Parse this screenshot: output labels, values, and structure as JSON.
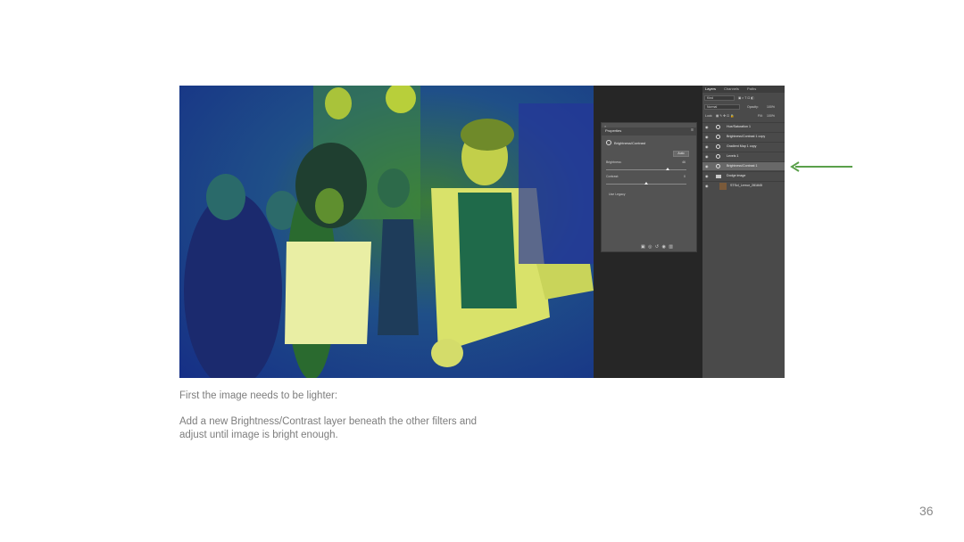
{
  "photoshop": {
    "properties_panel": {
      "tab_label": "Properties",
      "adjustment_title": "Brightness/Contrast",
      "auto_button": "Auto",
      "brightness": {
        "label": "Brightness:",
        "value": "46"
      },
      "contrast": {
        "label": "Contrast:",
        "value": "0"
      },
      "use_legacy_label": "Use Legacy"
    },
    "layers_panel": {
      "tabs": [
        "Layers",
        "Channels",
        "Paths"
      ],
      "filter_kind": "Kind",
      "blend_mode": "Normal",
      "opacity_label": "Opacity:",
      "opacity_value": "100%",
      "lock_label": "Lock:",
      "fill_label": "Fill:",
      "fill_value": "100%",
      "layers": [
        {
          "name": "Hue/Saturation 1",
          "type": "adjustment",
          "selected": false
        },
        {
          "name": "Brightness/Contrast 1 copy",
          "type": "adjustment",
          "selected": false
        },
        {
          "name": "Gradient Map 1 copy",
          "type": "adjustment",
          "selected": false
        },
        {
          "name": "Levels 1",
          "type": "adjustment",
          "selected": false
        },
        {
          "name": "Brightness/Contrast 1",
          "type": "adjustment",
          "selected": true
        },
        {
          "name": "Dodge image",
          "type": "group",
          "selected": false
        },
        {
          "name": "STScI_Lemur_281845",
          "type": "image",
          "selected": false
        }
      ]
    }
  },
  "arrow_color": "#5aa04a",
  "caption": {
    "line1": "First the image needs to be lighter:",
    "line2": "Add a new Brightness/Contrast layer beneath the other filters and adjust until image is bright enough."
  },
  "page_number": "36"
}
